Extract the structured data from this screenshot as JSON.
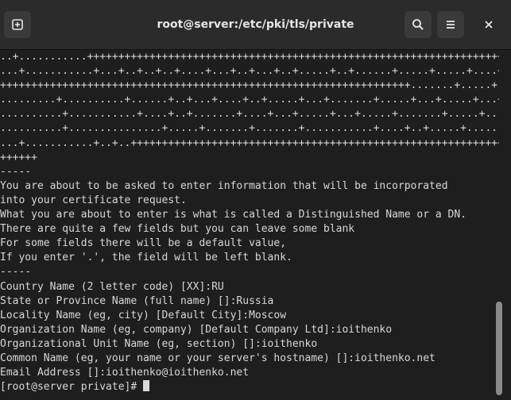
{
  "window": {
    "title": "root@server:/etc/pki/tls/private"
  },
  "icons": {
    "new_tab": "new-tab-icon",
    "search": "search-icon",
    "menu": "hamburger-menu-icon",
    "close": "close-icon"
  },
  "terminal": {
    "lines": [
      "..+...........+++++++++++++++++++++++++++++++++++++++++++++++++++++++++++++++++++++",
      "...+...........+...+..+..+..+....+...+..+...+..+.....+..+......+.....+.....+....+..+",
      "++++++++++++++++++++++++++++++++++++++++++++++++++++++++++++++++++.......+.....+...",
      ".........+..........+......+..+...+....+..+.....+...+.......+.....+...+.....+...+...",
      "..........+...........+....+..+.......+....+...+.....+...+.....+.......+.....+......",
      "..........+...............+.....+.......+.......+...........+....+..+.....+......+..",
      "...+...........+..+..++++++++++++++++++++++++++++++++++++++++++++++++++++++++++++++++",
      "++++++",
      "-----",
      "You are about to be asked to enter information that will be incorporated",
      "into your certificate request.",
      "What you are about to enter is what is called a Distinguished Name or a DN.",
      "There are quite a few fields but you can leave some blank",
      "For some fields there will be a default value,",
      "If you enter '.', the field will be left blank.",
      "-----",
      "Country Name (2 letter code) [XX]:RU",
      "State or Province Name (full name) []:Russia",
      "Locality Name (eg, city) [Default City]:Moscow",
      "Organization Name (eg, company) [Default Company Ltd]:ioithenko",
      "Organizational Unit Name (eg, section) []:ioithenko",
      "Common Name (eg, your name or your server's hostname) []:ioithenko.net",
      "Email Address []:ioithenko@ioithenko.net"
    ],
    "prompt": "[root@server private]# "
  },
  "colors": {
    "background": "#1e1e1e",
    "titlebar": "#2b2b2b",
    "text": "#d8d8d8",
    "button": "#3a3a3a"
  }
}
